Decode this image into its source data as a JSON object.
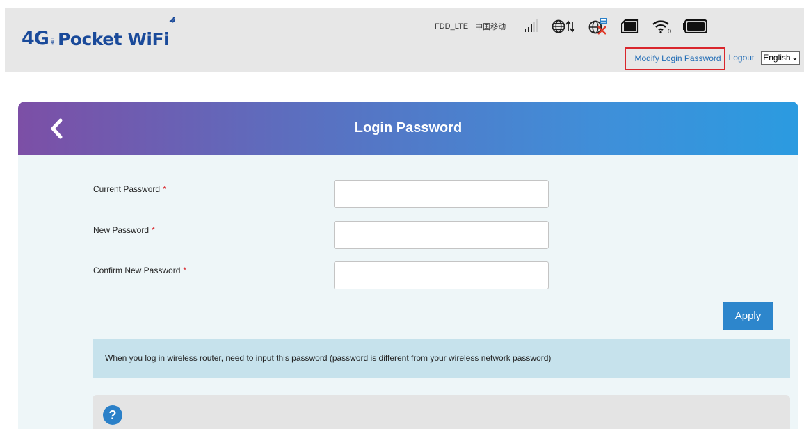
{
  "header": {
    "logo": {
      "prefix": "4G",
      "lte": "LTE",
      "text": "Pocket WiFi"
    },
    "status": {
      "network_type": "FDD_LTE",
      "carrier": "中国移动",
      "icons": [
        "signal-strength-icon",
        "globe-data-icon",
        "globe-disconnected-icon",
        "sim-card-icon",
        "wifi-icon",
        "battery-icon"
      ],
      "wifi_clients": "0"
    },
    "links": {
      "modify_password": "Modify Login Password",
      "logout": "Logout",
      "language": "English"
    }
  },
  "card": {
    "title": "Login Password",
    "fields": [
      {
        "label": "Current Password",
        "required_mark": "*",
        "value": ""
      },
      {
        "label": "New Password",
        "required_mark": "*",
        "value": ""
      },
      {
        "label": "Confirm New Password",
        "required_mark": "*",
        "value": ""
      }
    ],
    "apply_label": "Apply",
    "info_text": "When you log in wireless router, need to input this password (password is different from your wireless network password)",
    "help_label": "?"
  },
  "colors": {
    "accent": "#2d86cc",
    "highlight_border": "#d9262c",
    "header_gradient_start": "#7c4fa6",
    "header_gradient_end": "#2b9be0",
    "info_background": "#c6e2ec"
  }
}
